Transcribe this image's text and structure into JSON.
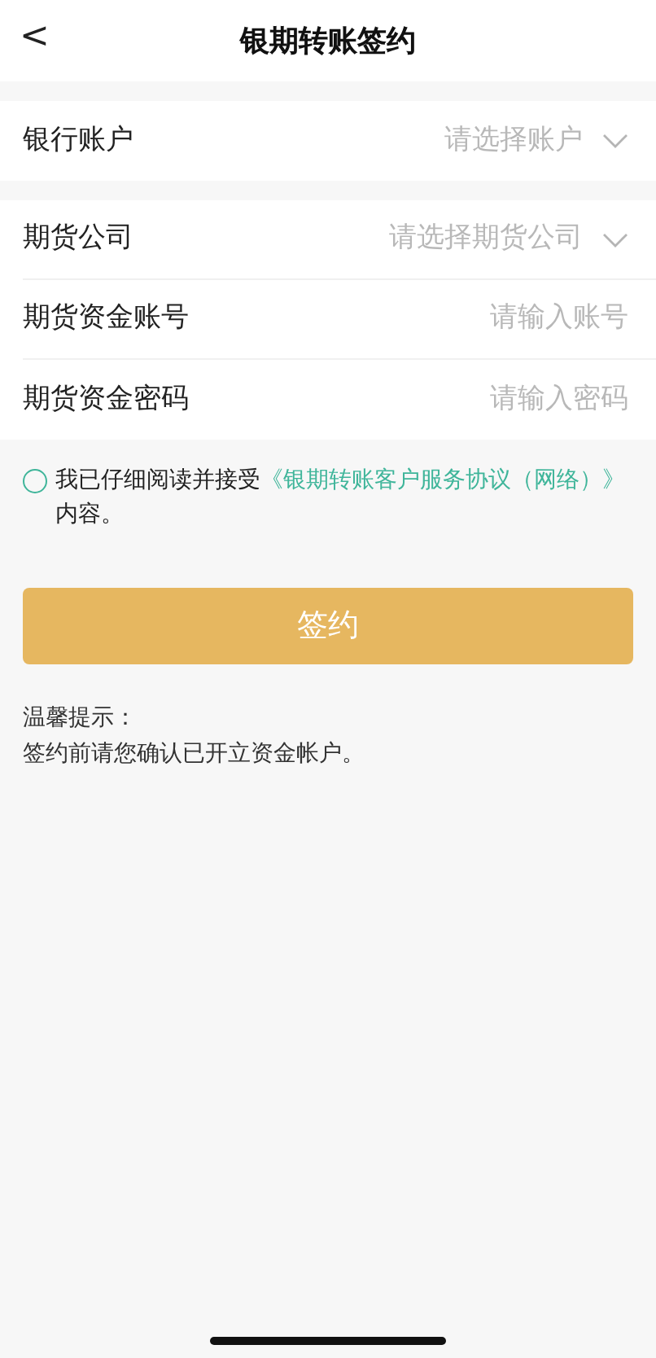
{
  "header": {
    "back": "<",
    "title": "银期转账签约"
  },
  "groups": [
    {
      "rows": [
        {
          "kind": "select",
          "label": "银行账户",
          "placeholder": "请选择账户"
        }
      ]
    },
    {
      "rows": [
        {
          "kind": "select",
          "label": "期货公司",
          "placeholder": "请选择期货公司"
        },
        {
          "kind": "input",
          "label": "期货资金账号",
          "placeholder": "请输入账号"
        },
        {
          "kind": "input",
          "label": "期货资金密码",
          "placeholder": "请输入密码"
        }
      ]
    }
  ],
  "agreement": {
    "checked": false,
    "prefix": "我已仔细阅读并接受",
    "link": "《银期转账客户服务协议（网络）》",
    "suffix": "内容。"
  },
  "submit": {
    "label": "签约",
    "disabled": true
  },
  "tips": [
    "温馨提示：",
    "签约前请您确认已开立资金帐户。"
  ]
}
